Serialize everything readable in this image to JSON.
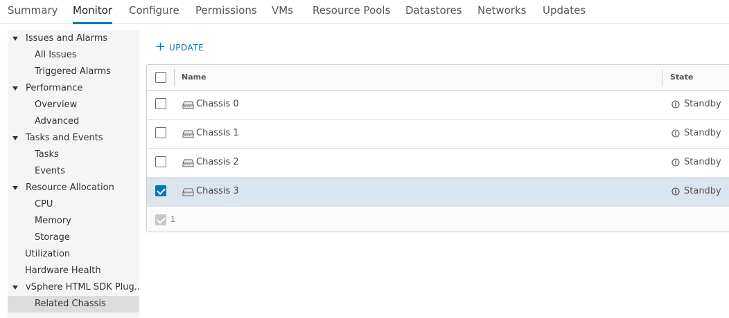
{
  "tabs": [
    {
      "label": "Summary",
      "active": false
    },
    {
      "label": "Monitor",
      "active": true
    },
    {
      "label": "Configure",
      "active": false
    },
    {
      "label": "Permissions",
      "active": false
    },
    {
      "label": "VMs",
      "active": false
    },
    {
      "label": "Resource Pools",
      "active": false
    },
    {
      "label": "Datastores",
      "active": false
    },
    {
      "label": "Networks",
      "active": false
    },
    {
      "label": "Updates",
      "active": false
    }
  ],
  "tree": [
    {
      "label": "Issues and Alarms",
      "expanded": true
    },
    {
      "label": "All Issues"
    },
    {
      "label": "Triggered Alarms"
    },
    {
      "label": "Performance",
      "expanded": true
    },
    {
      "label": "Overview"
    },
    {
      "label": "Advanced"
    },
    {
      "label": "Tasks and Events",
      "expanded": true
    },
    {
      "label": "Tasks"
    },
    {
      "label": "Events"
    },
    {
      "label": "Resource Allocation",
      "expanded": true
    },
    {
      "label": "CPU"
    },
    {
      "label": "Memory"
    },
    {
      "label": "Storage"
    },
    {
      "label": "Utilization"
    },
    {
      "label": "Hardware Health"
    },
    {
      "label": "vSphere HTML SDK Plug...",
      "expanded": true
    },
    {
      "label": "Related Chassis",
      "selected": true
    }
  ],
  "toolbar": {
    "update_label": "UPDATE",
    "plus_icon": "plus-icon"
  },
  "grid": {
    "columns": {
      "name": "Name",
      "state": "State"
    },
    "rows": [
      {
        "name": "Chassis 0",
        "state": "Standby",
        "checked": false
      },
      {
        "name": "Chassis 1",
        "state": "Standby",
        "checked": false
      },
      {
        "name": "Chassis 2",
        "state": "Standby",
        "checked": false
      },
      {
        "name": "Chassis 3",
        "state": "Standby",
        "checked": true
      }
    ],
    "footer_count": "1"
  },
  "colors": {
    "accent": "#0079b8",
    "selected_row": "#dae5ee",
    "tree_bg": "#f5f5f5"
  }
}
